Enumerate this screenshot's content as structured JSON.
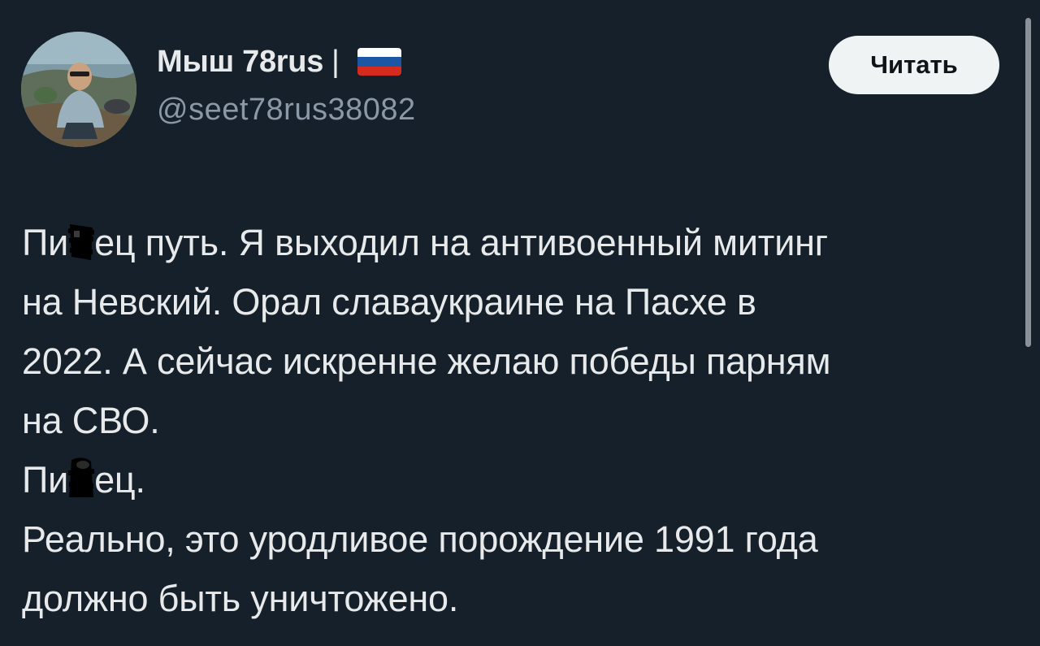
{
  "author": {
    "display_name": "Мыш 78rus",
    "separator": "|",
    "flag_icon": "russia-flag-icon",
    "flag_colors": [
      "#ffffff",
      "#1c57a5",
      "#d52b1e"
    ],
    "handle": "@seet78rus38082",
    "avatar_icon": "user-avatar-photo"
  },
  "follow_button": {
    "label": "Читать"
  },
  "tweet": {
    "lines": [
      {
        "before": "Пи",
        "censored": true,
        "after": "ец путь. Я выходил на антивоенный митинг"
      },
      {
        "before": "на Невский. Орал славаукраине на Пасхе в",
        "censored": false,
        "after": ""
      },
      {
        "before": "2022. А сейчас искренне желаю победы парням",
        "censored": false,
        "after": ""
      },
      {
        "before": "на СВО.",
        "censored": false,
        "after": ""
      },
      {
        "before": "Пи",
        "censored": true,
        "after": "ец."
      },
      {
        "before": "Реально, это уродливое порождение 1991 года",
        "censored": false,
        "after": ""
      },
      {
        "before": "должно быть уничтожено.",
        "censored": false,
        "after": ""
      }
    ]
  },
  "colors": {
    "background": "#15202b",
    "text": "#e7e9ea",
    "secondary_text": "#8b98a5",
    "button_bg": "#eff3f4",
    "button_text": "#0f1419"
  }
}
